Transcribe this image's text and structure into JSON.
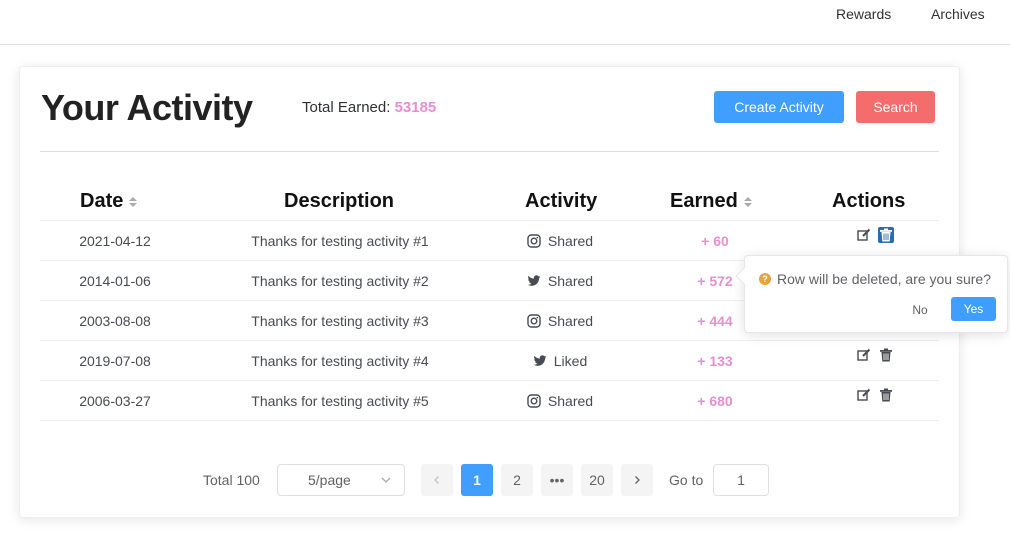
{
  "nav": {
    "rewards": "Rewards",
    "archives": "Archives"
  },
  "header": {
    "title": "Your Activity",
    "total_label": "Total Earned: ",
    "total_value": "53185",
    "create_button": "Create Activity",
    "search_button": "Search"
  },
  "table": {
    "columns": {
      "date": "Date",
      "description": "Description",
      "activity": "Activity",
      "earned": "Earned",
      "actions": "Actions"
    },
    "rows": [
      {
        "date": "2021-04-12",
        "description": "Thanks for testing activity #1",
        "activity_icon": "instagram-icon",
        "activity": "Shared",
        "earned": "+ 60"
      },
      {
        "date": "2014-01-06",
        "description": "Thanks for testing activity #2",
        "activity_icon": "twitter-icon",
        "activity": "Shared",
        "earned": "+ 572"
      },
      {
        "date": "2003-08-08",
        "description": "Thanks for testing activity #3",
        "activity_icon": "instagram-icon",
        "activity": "Shared",
        "earned": "+ 444"
      },
      {
        "date": "2019-07-08",
        "description": "Thanks for testing activity #4",
        "activity_icon": "twitter-icon",
        "activity": "Liked",
        "earned": "+ 133"
      },
      {
        "date": "2006-03-27",
        "description": "Thanks for testing activity #5",
        "activity_icon": "instagram-icon",
        "activity": "Shared",
        "earned": "+ 680"
      }
    ]
  },
  "pagination": {
    "total": "Total 100",
    "page_size": "5/page",
    "pages": [
      "1",
      "2",
      "•••",
      "20"
    ],
    "current_page": "1",
    "goto_label": "Go to",
    "goto_value": "1"
  },
  "popconfirm": {
    "message": "Row will be deleted, are you sure?",
    "no": "No",
    "yes": "Yes"
  },
  "colors": {
    "primary": "#409eff",
    "danger": "#f56c6c",
    "earned": "#e88fcf",
    "warning": "#e6a23c"
  }
}
